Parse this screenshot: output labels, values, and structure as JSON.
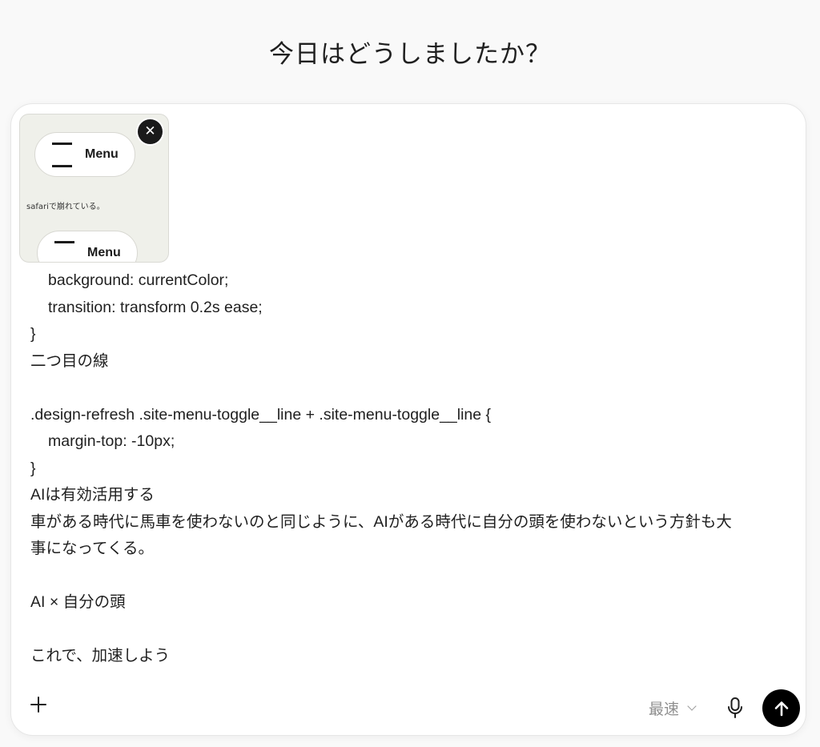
{
  "header": {
    "title": "今日はどうしましたか？"
  },
  "attachment": {
    "menu_label_1": "Menu",
    "menu_label_2": "Menu",
    "caption": "safariで崩れている。",
    "remove_icon": "close-icon"
  },
  "message": {
    "lines": [
      "background: currentColor;",
      "transition: transform 0.2s ease;",
      "}",
      "二つ目の線",
      "",
      ".design-refresh .site-menu-toggle__line + .site-menu-toggle__line {",
      "margin-top: -10px;",
      "}",
      "AIは有効活用する",
      "車がある時代に馬車を使わないのと同じように、AIがある時代に自分の頭を使わないという方針も大",
      "事になってくる。",
      "",
      "AI × 自分の頭",
      "",
      "これで、加速しよう"
    ]
  },
  "toolbar": {
    "add_icon": "plus-icon",
    "model_label": "最速",
    "mic_icon": "microphone-icon",
    "send_icon": "arrow-up-icon"
  }
}
